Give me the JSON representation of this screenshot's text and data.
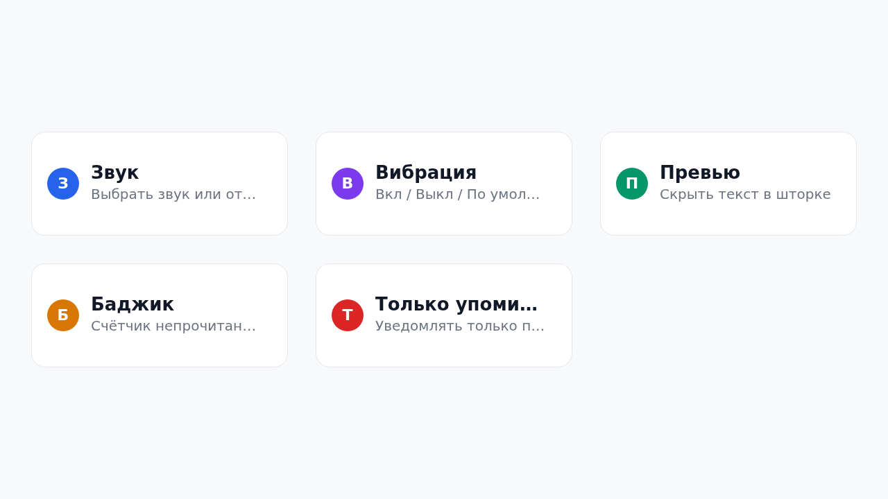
{
  "cards": [
    {
      "avatar": "З",
      "color": "#2563eb",
      "title": "Звук",
      "subtitle": "Выбрать звук или от…"
    },
    {
      "avatar": "В",
      "color": "#7c3aed",
      "title": "Вибрация",
      "subtitle": "Вкл / Выкл / По умол…"
    },
    {
      "avatar": "П",
      "color": "#059669",
      "title": "Превью",
      "subtitle": "Скрыть текст в шторке"
    },
    {
      "avatar": "Б",
      "color": "#d97706",
      "title": "Баджик",
      "subtitle": "Счётчик непрочитан…"
    },
    {
      "avatar": "Т",
      "color": "#dc2626",
      "title": "Только упоми…",
      "subtitle": "Уведомлять только п…"
    }
  ]
}
